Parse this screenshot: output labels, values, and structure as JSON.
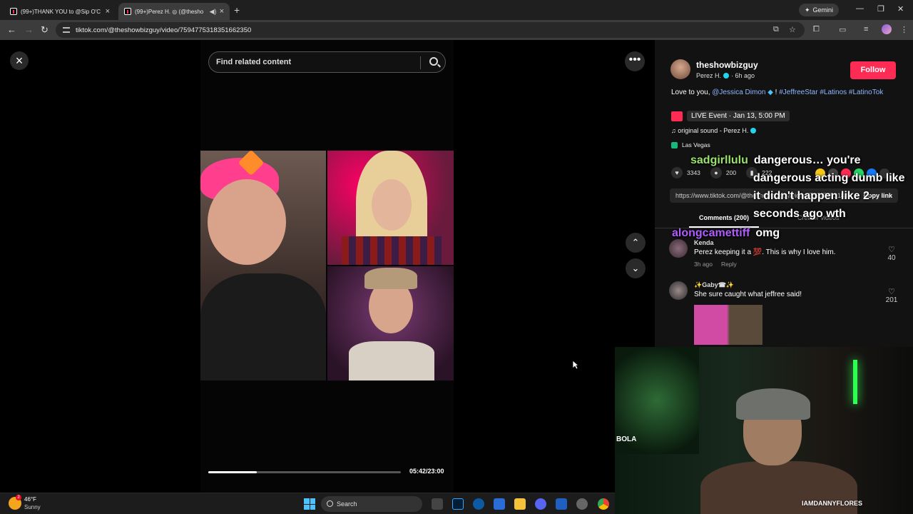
{
  "browser": {
    "tabs": [
      {
        "title": "(99+)THANK YOU to @Sip O'C"
      },
      {
        "title": "(99+)Perez H. ◎ (@thesho"
      }
    ],
    "gemini_label": "Gemini",
    "url": "tiktok.com/@theshowbizguy/video/7594775318351662350"
  },
  "video": {
    "search_placeholder": "Find related content",
    "progress_fraction": 0.25,
    "time": "05:42/23:00"
  },
  "post": {
    "username": "theshowbizguy",
    "display_name": "Perez H.",
    "age": "· 6h ago",
    "follow_label": "Follow",
    "caption_lead": "Love to you, ",
    "caption_mention": "@Jessica Dimon",
    "caption_mid": " ! ",
    "caption_tags": "#JeffreeStar #Latinos #LatinoTok",
    "live_event": "LIVE Event · Jan 13, 5:00 PM",
    "sound": "original sound - Perez H.",
    "location": "Las Vegas",
    "likes": "3343",
    "comments_count": "200",
    "saves": "222",
    "link": "https://www.tiktok.com/@theshowbizguy/video/759477531835...",
    "copy_link_label": "Copy link",
    "tab_comments": "Comments (200)",
    "tab_creator_videos": "Creator videos"
  },
  "comments": [
    {
      "name": "Kenda",
      "text": "Perez keeping it a 💯. This is why I love him.",
      "age": "3h ago",
      "reply": "Reply",
      "likes": "40"
    },
    {
      "name": "✨Gaby☎✨",
      "text": "She sure caught what jeffree said!",
      "likes": "201"
    }
  ],
  "stream_chat": [
    {
      "user": "sadgirllulu",
      "user_color": "#9be36a",
      "msg1": "dangerous… you're",
      "msg2": "dangerous acting dumb like",
      "msg3": "it didn't happen like 2",
      "msg4": "seconds ago wth"
    },
    {
      "user": "alongcamettiff",
      "user_color": "#b05cff",
      "msg1": "omg"
    }
  ],
  "webcam": {
    "handle": "IAMDANNYFLORES",
    "sign": "BOLA"
  },
  "taskbar": {
    "temp": "46°F",
    "condition": "Sunny",
    "search_label": "Search",
    "badge": "2"
  },
  "colors": {
    "accent": "#fe2c55",
    "verified": "#20d5ec",
    "link": "#8fb6ff"
  }
}
